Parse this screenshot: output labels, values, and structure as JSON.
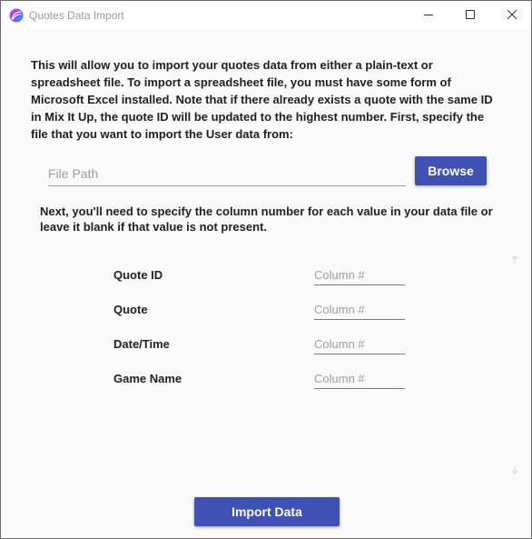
{
  "window": {
    "title": "Quotes Data Import",
    "icon": "mixitup-logo-icon",
    "controls": [
      "minimize-icon",
      "maximize-icon",
      "close-icon"
    ]
  },
  "intro_text": "This will allow you to import your quotes data from either a plain-text or spreadsheet file. To import a spreadsheet file, you must have some form of Microsoft Excel installed. Note that if there already exists a quote with the same ID in Mix It Up, the quote ID will be updated to the highest number. First, specify the file that you want to import the User data from:",
  "file_path": {
    "placeholder": "File Path",
    "value": ""
  },
  "browse_label": "Browse",
  "next_text": "Next, you'll need to specify the column number for each value in your data file or leave it blank if that value is not present.",
  "columns": [
    {
      "label": "Quote ID",
      "placeholder": "Column #",
      "value": ""
    },
    {
      "label": "Quote",
      "placeholder": "Column #",
      "value": ""
    },
    {
      "label": "Date/Time",
      "placeholder": "Column #",
      "value": ""
    },
    {
      "label": "Game Name",
      "placeholder": "Column #",
      "value": ""
    }
  ],
  "import_label": "Import Data",
  "colors": {
    "accent": "#3f51b5",
    "background": "#fafafa"
  }
}
